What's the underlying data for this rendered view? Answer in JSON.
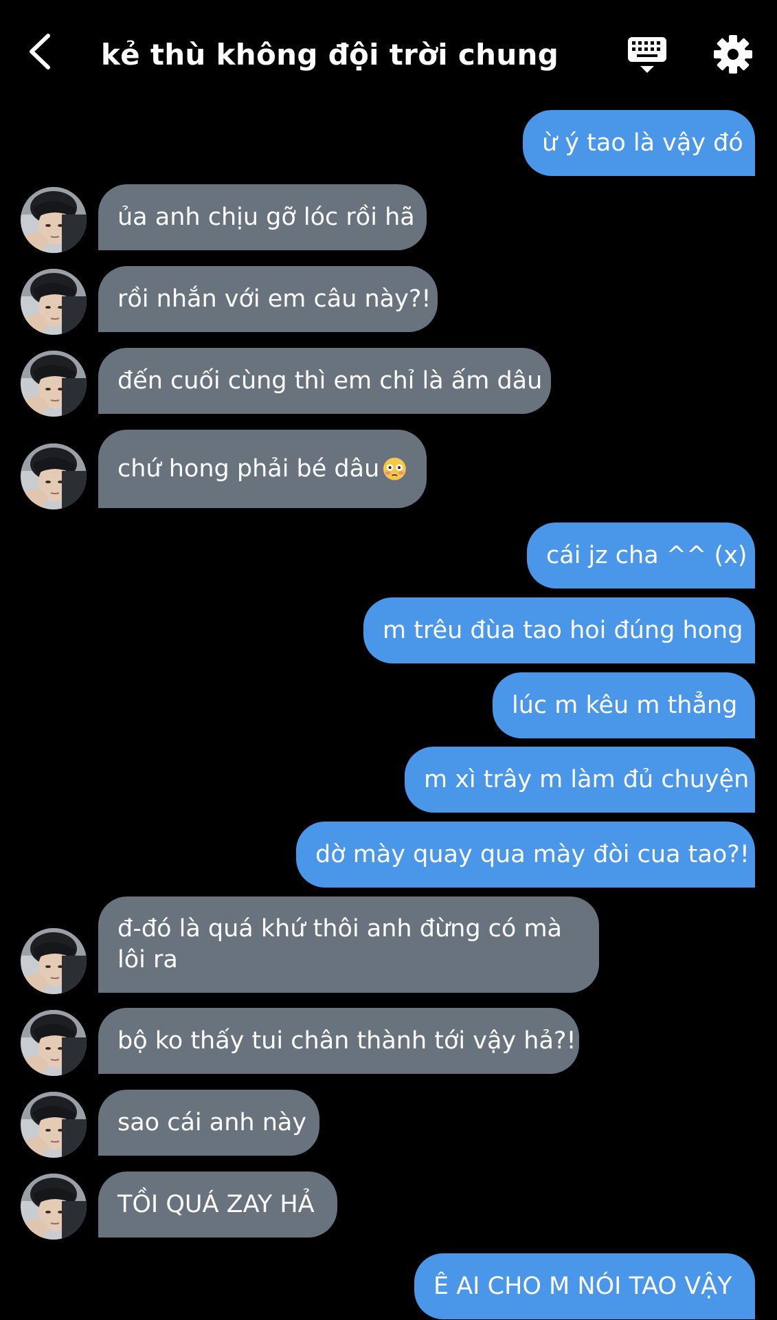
{
  "header": {
    "title": "kẻ thù không đội trời chung",
    "back_icon": "chevron-left-icon",
    "keyboard_icon": "keyboard-icon",
    "settings_icon": "gear-icon"
  },
  "colors": {
    "background": "#000000",
    "sent_bubble": "#4a96e8",
    "received_bubble": "#68737d",
    "text": "#ffffff"
  },
  "messages": [
    {
      "side": "sent",
      "text": "ừ ý tao là vậy đó"
    },
    {
      "side": "received",
      "text": "ủa anh chịu gỡ lóc rồi hã"
    },
    {
      "side": "received",
      "text": "rồi nhắn với em câu này?!"
    },
    {
      "side": "received",
      "text": "đến cuối cùng thì em chỉ là ấm dâu"
    },
    {
      "side": "received",
      "text": "chứ hong phải bé dâu"
    },
    {
      "side": "sent",
      "text": "cái jz cha ^^ (x)"
    },
    {
      "side": "sent",
      "text": "m trêu đùa tao hoi đúng hong"
    },
    {
      "side": "sent",
      "text": "lúc m kêu m thẳng"
    },
    {
      "side": "sent",
      "text": "m xì trây m làm đủ chuyện"
    },
    {
      "side": "sent",
      "text": "dờ mày quay qua mày đòi cua tao?!"
    },
    {
      "side": "received",
      "text": "đ-đó là quá khứ thôi anh đừng có mà lôi ra"
    },
    {
      "side": "received",
      "text": "bộ ko thấy tui chân thành tới vậy hả?!"
    },
    {
      "side": "received",
      "text": "sao cái anh này"
    },
    {
      "side": "received",
      "text": "TỒI QUÁ ZAY HẢ"
    },
    {
      "side": "sent",
      "text": "Ê AI CHO M NÓI TAO VẬY"
    }
  ]
}
